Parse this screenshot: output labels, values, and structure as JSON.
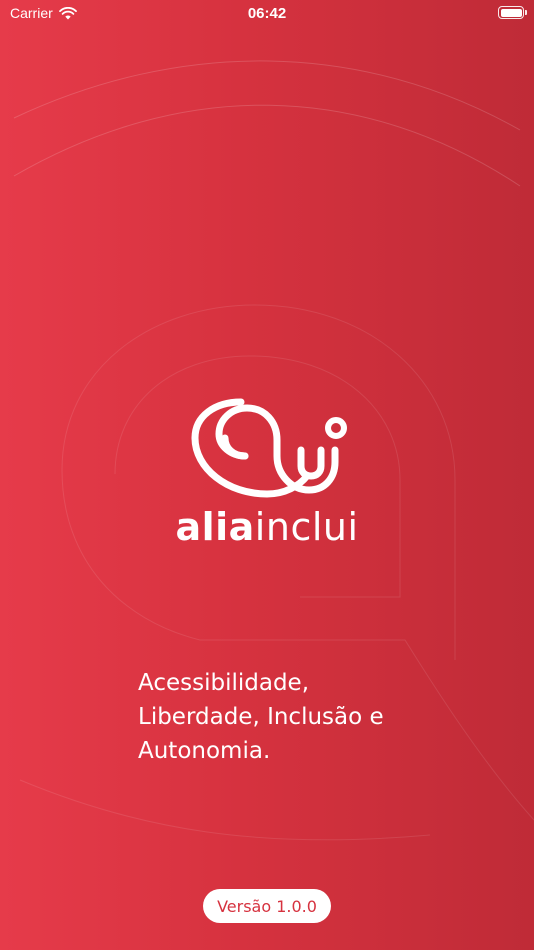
{
  "status_bar": {
    "carrier": "Carrier",
    "time": "06:42",
    "battery_level": 1.0,
    "icons": [
      "wifi-icon",
      "battery-icon"
    ]
  },
  "logo": {
    "brand_bold": "alia",
    "brand_light": "inclui"
  },
  "tagline": {
    "line1": "Acessibilidade,",
    "line2": "Liberdade, Inclusão e",
    "line3": "Autonomia."
  },
  "footer": {
    "version": "Versão 1.0.0"
  },
  "colors": {
    "background_start": "#e63b4a",
    "background_end": "#bf2b37",
    "foreground": "#ffffff",
    "accent": "#d6323f"
  }
}
